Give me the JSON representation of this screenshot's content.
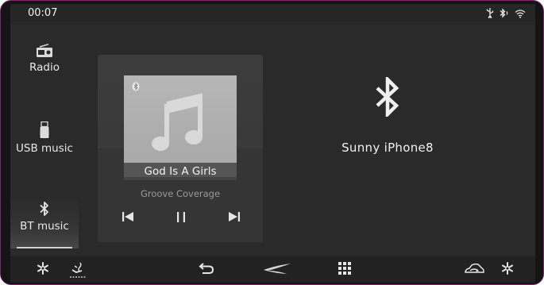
{
  "status": {
    "time": "00:07",
    "icons": [
      "usb-icon",
      "bluetooth-icon",
      "wifi-icon"
    ]
  },
  "sidebar": {
    "items": [
      {
        "label": "Radio",
        "icon": "radio-icon",
        "active": false
      },
      {
        "label": "USB music",
        "icon": "usb-drive-icon",
        "active": false
      },
      {
        "label": "BT music",
        "icon": "bluetooth-icon",
        "active": true
      }
    ]
  },
  "player": {
    "source_icon": "bluetooth-icon",
    "album_art_icon": "music-note-icon",
    "title": "God Is A Girls",
    "artist": "Groove Coverage",
    "controls": [
      "previous-track-icon",
      "pause-icon",
      "next-track-icon"
    ]
  },
  "device": {
    "icon": "bluetooth-icon",
    "name": "Sunny iPhone8"
  },
  "bottom_bar": {
    "items": [
      "fan-left-icon",
      "seat-heat-icon",
      "back-icon",
      "brand-logo-icon",
      "apps-grid-icon",
      "car-recirculation-icon",
      "fan-right-icon"
    ]
  },
  "colors": {
    "background": "#2a2a2a",
    "text": "#f2f2f2",
    "secondary_text": "#9a9a9a",
    "frame": "#7a2a6a"
  }
}
